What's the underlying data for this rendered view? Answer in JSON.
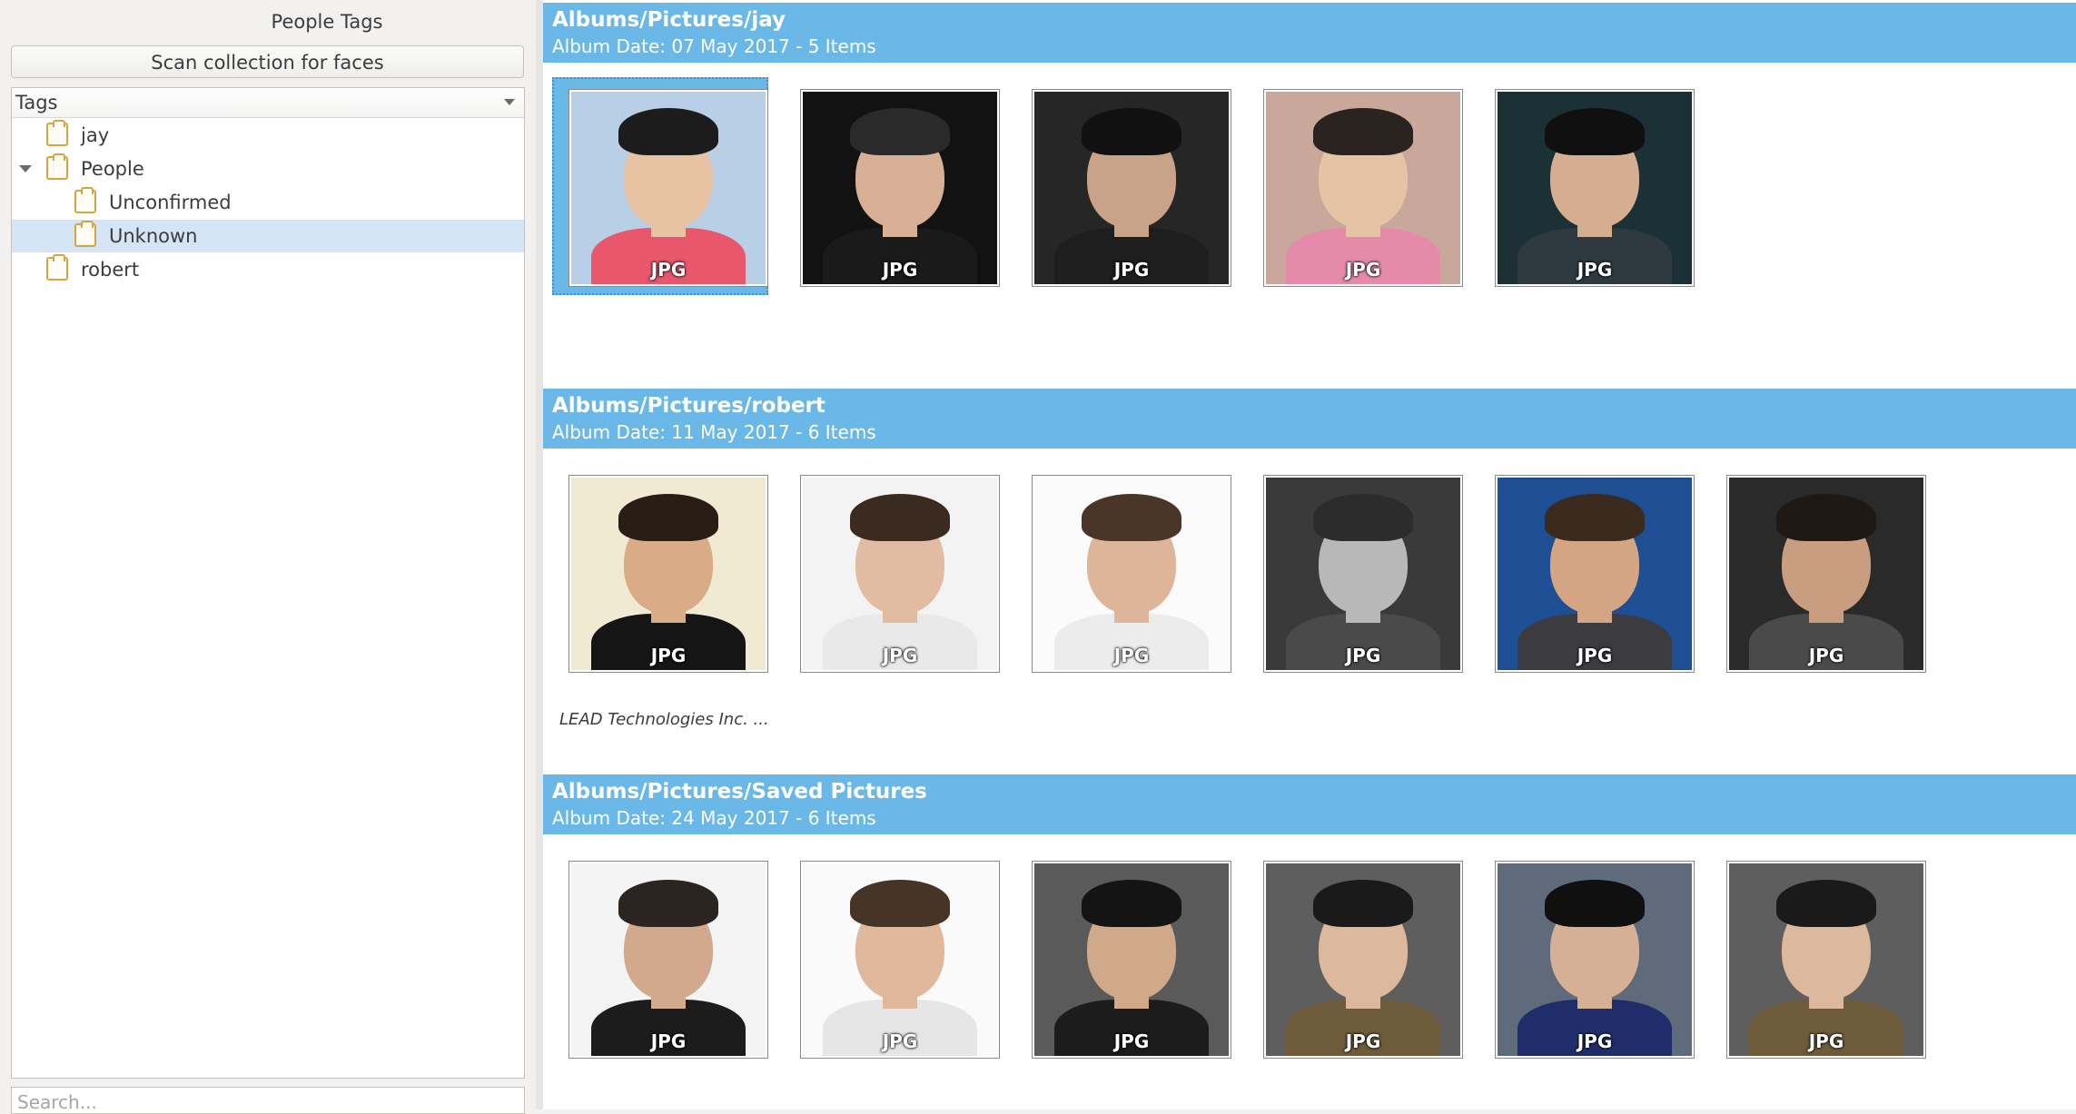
{
  "left_panel": {
    "title": "People Tags",
    "scan_button_label": "Scan collection for faces",
    "tags_header": "Tags",
    "tree": [
      {
        "label": "jay",
        "level": 0,
        "expanded": null,
        "selected": false
      },
      {
        "label": "People",
        "level": 0,
        "expanded": true,
        "selected": false
      },
      {
        "label": "Unconfirmed",
        "level": 1,
        "expanded": null,
        "selected": false
      },
      {
        "label": "Unknown",
        "level": 1,
        "expanded": null,
        "selected": true
      },
      {
        "label": "robert",
        "level": 0,
        "expanded": null,
        "selected": false
      }
    ],
    "search_placeholder": "Search..."
  },
  "albums": [
    {
      "title": "Albums/Pictures/jay",
      "subtitle": "Album Date: 07 May 2017 - 5 Items",
      "items": [
        {
          "label": "JPG",
          "selected": true,
          "bg": "#b9cfe6",
          "skin": "#e7c3a3",
          "hair": "#1c1c1c",
          "cloth": "#e8576b"
        },
        {
          "label": "JPG",
          "selected": false,
          "bg": "#121212",
          "skin": "#d7b096",
          "hair": "#2a2a2a",
          "cloth": "#1a1a1a"
        },
        {
          "label": "JPG",
          "selected": false,
          "bg": "#262626",
          "skin": "#c9a387",
          "hair": "#111111",
          "cloth": "#1e1e1e"
        },
        {
          "label": "JPG",
          "selected": false,
          "bg": "#c9a79a",
          "skin": "#e5c4a6",
          "hair": "#2b2320",
          "cloth": "#e58aa9"
        },
        {
          "label": "JPG",
          "selected": false,
          "bg": "#1c3136",
          "skin": "#d5ae92",
          "hair": "#101010",
          "cloth": "#2e3a40"
        }
      ],
      "caption": ""
    },
    {
      "title": "Albums/Pictures/robert",
      "subtitle": "Album Date: 11 May 2017 - 6 Items",
      "items": [
        {
          "label": "JPG",
          "selected": false,
          "bg": "#f1ead2",
          "skin": "#d9ab86",
          "hair": "#2a1d15",
          "cloth": "#151515"
        },
        {
          "label": "JPG",
          "selected": false,
          "bg": "#f3f3f3",
          "skin": "#e2bca0",
          "hair": "#3a2a20",
          "cloth": "#e9e9e9"
        },
        {
          "label": "JPG",
          "selected": false,
          "bg": "#fbfbfb",
          "skin": "#deb598",
          "hair": "#4a3628",
          "cloth": "#ececec"
        },
        {
          "label": "JPG",
          "selected": false,
          "bg": "#3a3a3a",
          "skin": "#b8b8b8",
          "hair": "#2c2c2c",
          "cloth": "#4a4a4a"
        },
        {
          "label": "JPG",
          "selected": false,
          "bg": "#1e4f94",
          "skin": "#d4a583",
          "hair": "#3b2a1e",
          "cloth": "#3c3c40"
        },
        {
          "label": "JPG",
          "selected": false,
          "bg": "#2a2a2a",
          "skin": "#c89d80",
          "hair": "#1e1915",
          "cloth": "#4a4a4a"
        }
      ],
      "caption": "LEAD Technologies Inc. ..."
    },
    {
      "title": "Albums/Pictures/Saved Pictures",
      "subtitle": "Album Date: 24 May 2017 - 6 Items",
      "items": [
        {
          "label": "JPG",
          "selected": false,
          "bg": "#f4f4f4",
          "skin": "#d2a98c",
          "hair": "#2c2420",
          "cloth": "#1c1c1c"
        },
        {
          "label": "JPG",
          "selected": false,
          "bg": "#fafafa",
          "skin": "#e0b99c",
          "hair": "#463427",
          "cloth": "#e6e6e6"
        },
        {
          "label": "JPG",
          "selected": false,
          "bg": "#5a5a5a",
          "skin": "#d0a88a",
          "hair": "#141414",
          "cloth": "#1c1c1c"
        },
        {
          "label": "JPG",
          "selected": false,
          "bg": "#5e5e5e",
          "skin": "#dcb89c",
          "hair": "#1a1a1a",
          "cloth": "#6e5b3a"
        },
        {
          "label": "JPG",
          "selected": false,
          "bg": "#5f6a7a",
          "skin": "#d6b095",
          "hair": "#101010",
          "cloth": "#1f2e6a"
        },
        {
          "label": "JPG",
          "selected": false,
          "bg": "#5e5e5e",
          "skin": "#dcb89c",
          "hair": "#1a1a1a",
          "cloth": "#6e5b3a"
        }
      ],
      "caption": ""
    }
  ],
  "colors": {
    "accent": "#6ab8e8",
    "selection_light": "#d6e5f5",
    "tag_icon": "#d9a440"
  }
}
